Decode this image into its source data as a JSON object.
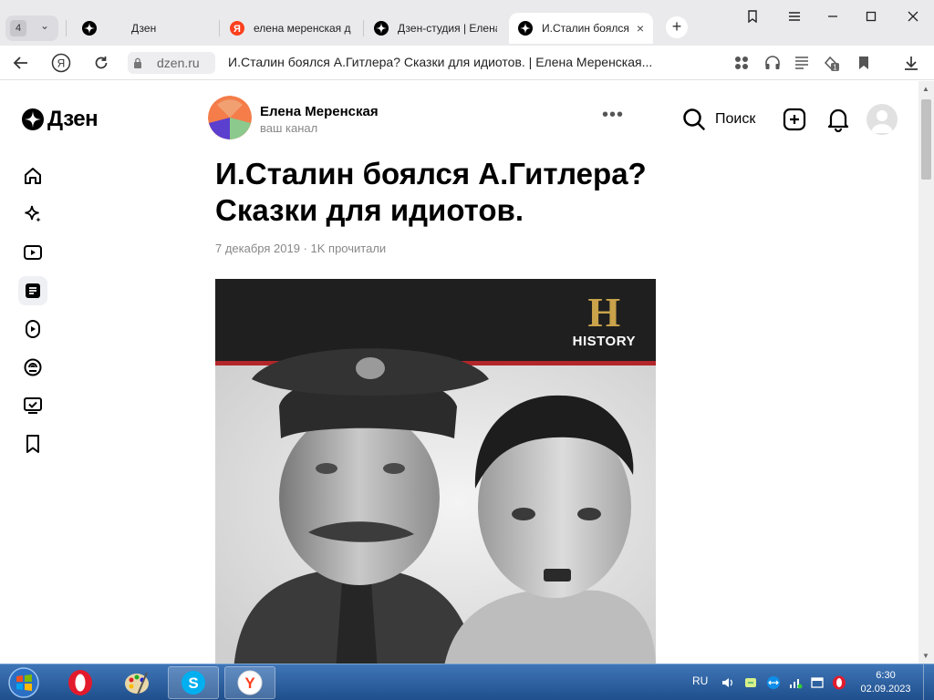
{
  "browser": {
    "tab_count": "4",
    "tabs": [
      {
        "label": "Дзен"
      },
      {
        "label": "елена меренская д"
      },
      {
        "label": "Дзен-студия | Елена"
      },
      {
        "label": "И.Сталин боялся"
      }
    ],
    "address": {
      "domain": "dzen.ru",
      "page_title": "И.Сталин боялся А.Гитлера? Сказки для идиотов. | Елена Меренская..."
    },
    "tab_close": "×",
    "new_tab": "+"
  },
  "site": {
    "logo_text": "Дзен",
    "channel": {
      "name": "Елена Меренская",
      "subtitle": "ваш канал"
    },
    "header": {
      "more": "•••",
      "search_label": "Поиск"
    }
  },
  "article": {
    "title": "И.Сталин боялся А.Гитлера? Сказки для идиотов.",
    "meta": "7 декабря 2019 · 1K прочитали",
    "image_logo": {
      "letter": "H",
      "word": "HISTORY"
    }
  },
  "taskbar": {
    "lang": "RU",
    "time": "6:30",
    "date": "02.09.2023"
  },
  "colors": {
    "tabbar_bg": "#eaeaec",
    "yandex_red": "#fc3f1d",
    "history_gold": "#c9a24a",
    "history_red_line": "#b3262a",
    "taskbar_blue": "#2b5f9e"
  }
}
